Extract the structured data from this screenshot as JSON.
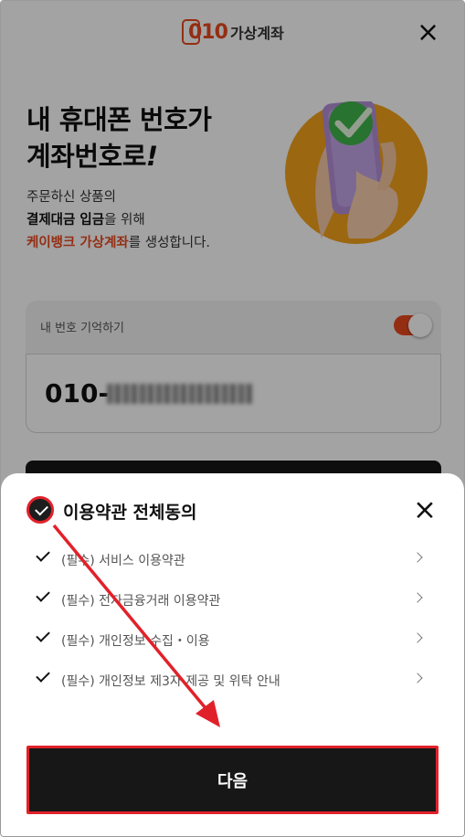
{
  "header": {
    "logo_digits": "010",
    "logo_name": "가상계좌",
    "close_icon": "close-icon"
  },
  "hero": {
    "title_line1": "내 휴대폰 번호가",
    "title_line2": "계좌번호로",
    "title_exclaim": "!",
    "desc_line1": "주문하신 상품의",
    "desc_line2_bold": "결제대금 입금",
    "desc_line2_rest": "을 위해",
    "desc_line3_accent": "케이뱅크 가상계좌",
    "desc_line3_rest": "를 생성합니다.",
    "illustration_icon": "phone-checkmark-illustration"
  },
  "form": {
    "remember_label": "내 번호 기억하기",
    "remember_on": true,
    "phone_prefix": "010-"
  },
  "sheet": {
    "all_agree_label": "이용약관 전체동의",
    "all_agree_checked": true,
    "items": [
      {
        "label": "(필수) 서비스 이용약관",
        "checked": true
      },
      {
        "label": "(필수) 전자금융거래 이용약관",
        "checked": true
      },
      {
        "label": "(필수) 개인정보 수집・이용",
        "checked": true
      },
      {
        "label": "(필수) 개인정보 제3자 제공 및 위탁 안내",
        "checked": true
      }
    ],
    "next_label": "다음"
  },
  "colors": {
    "accent": "#e8491f",
    "highlight": "#e1212a",
    "dark": "#171717"
  }
}
